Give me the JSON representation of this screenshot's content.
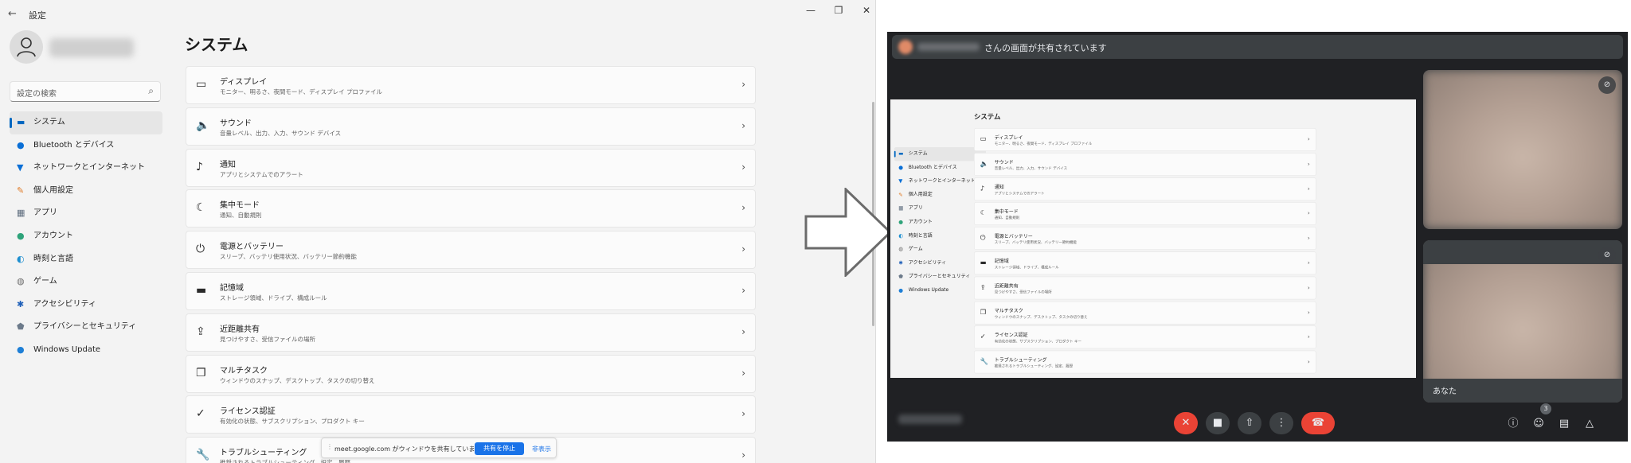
{
  "settings": {
    "window_title": "設定",
    "search_placeholder": "設定の検索",
    "page_title": "システム",
    "nav": [
      {
        "label": "システム",
        "icon": "display-icon",
        "glyph": "▬",
        "color": "#0067c0",
        "selected": true
      },
      {
        "label": "Bluetooth とデバイス",
        "icon": "bluetooth-icon",
        "glyph": "●",
        "color": "#0a6fd6"
      },
      {
        "label": "ネットワークとインターネット",
        "icon": "wifi-icon",
        "glyph": "▼",
        "color": "#0a6fd6"
      },
      {
        "label": "個人用設定",
        "icon": "brush-icon",
        "glyph": "✎",
        "color": "#e07a25"
      },
      {
        "label": "アプリ",
        "icon": "apps-icon",
        "glyph": "▦",
        "color": "#5c6b7c"
      },
      {
        "label": "アカウント",
        "icon": "account-icon",
        "glyph": "●",
        "color": "#2ea37a"
      },
      {
        "label": "時刻と言語",
        "icon": "globe-icon",
        "glyph": "◐",
        "color": "#1e8fd0"
      },
      {
        "label": "ゲーム",
        "icon": "gamepad-icon",
        "glyph": "◍",
        "color": "#6d6d6d"
      },
      {
        "label": "アクセシビリティ",
        "icon": "accessibility-icon",
        "glyph": "✱",
        "color": "#1e5fb8"
      },
      {
        "label": "プライバシーとセキュリティ",
        "icon": "shield-icon",
        "glyph": "⬟",
        "color": "#6c7a8a"
      },
      {
        "label": "Windows Update",
        "icon": "update-icon",
        "glyph": "●",
        "color": "#1e7fd6"
      }
    ],
    "cards": [
      {
        "title": "ディスプレイ",
        "sub": "モニター、明るさ、夜間モード、ディスプレイ プロファイル",
        "icon": "monitor-icon",
        "glyph": "▭"
      },
      {
        "title": "サウンド",
        "sub": "音量レベル、出力、入力、サウンド デバイス",
        "icon": "speaker-icon",
        "glyph": "🔈"
      },
      {
        "title": "通知",
        "sub": "アプリとシステムでのアラート",
        "icon": "bell-icon",
        "glyph": "♪"
      },
      {
        "title": "集中モード",
        "sub": "通知、自動規則",
        "icon": "moon-icon",
        "glyph": "☾"
      },
      {
        "title": "電源とバッテリー",
        "sub": "スリープ、バッテリ使用状況、バッテリー節約機能",
        "icon": "power-icon",
        "glyph": "⏻"
      },
      {
        "title": "記憶域",
        "sub": "ストレージ領域、ドライブ、構成ルール",
        "icon": "storage-icon",
        "glyph": "▬"
      },
      {
        "title": "近距離共有",
        "sub": "見つけやすさ、受信ファイルの場所",
        "icon": "share-icon",
        "glyph": "⇪"
      },
      {
        "title": "マルチタスク",
        "sub": "ウィンドウのスナップ、デスクトップ、タスクの切り替え",
        "icon": "multitask-icon",
        "glyph": "❐"
      },
      {
        "title": "ライセンス認証",
        "sub": "有効化の状態、サブスクリプション、プロダクト キー",
        "icon": "check-circle-icon",
        "glyph": "✓"
      },
      {
        "title": "トラブルシューティング",
        "sub": "推奨されるトラブルシューティング、設定、履歴",
        "icon": "wrench-icon",
        "glyph": "🔧"
      }
    ],
    "share_bar": {
      "message": "meet.google.com がウィンドウを共有しています。",
      "stop_label": "共有を停止",
      "hide_label": "非表示"
    }
  },
  "meet": {
    "banner_text": "さんの画面が共有されています",
    "tile_self_name": "あなた",
    "participant_count": "3",
    "accent_red": "#ea4335",
    "background": "#202124"
  }
}
